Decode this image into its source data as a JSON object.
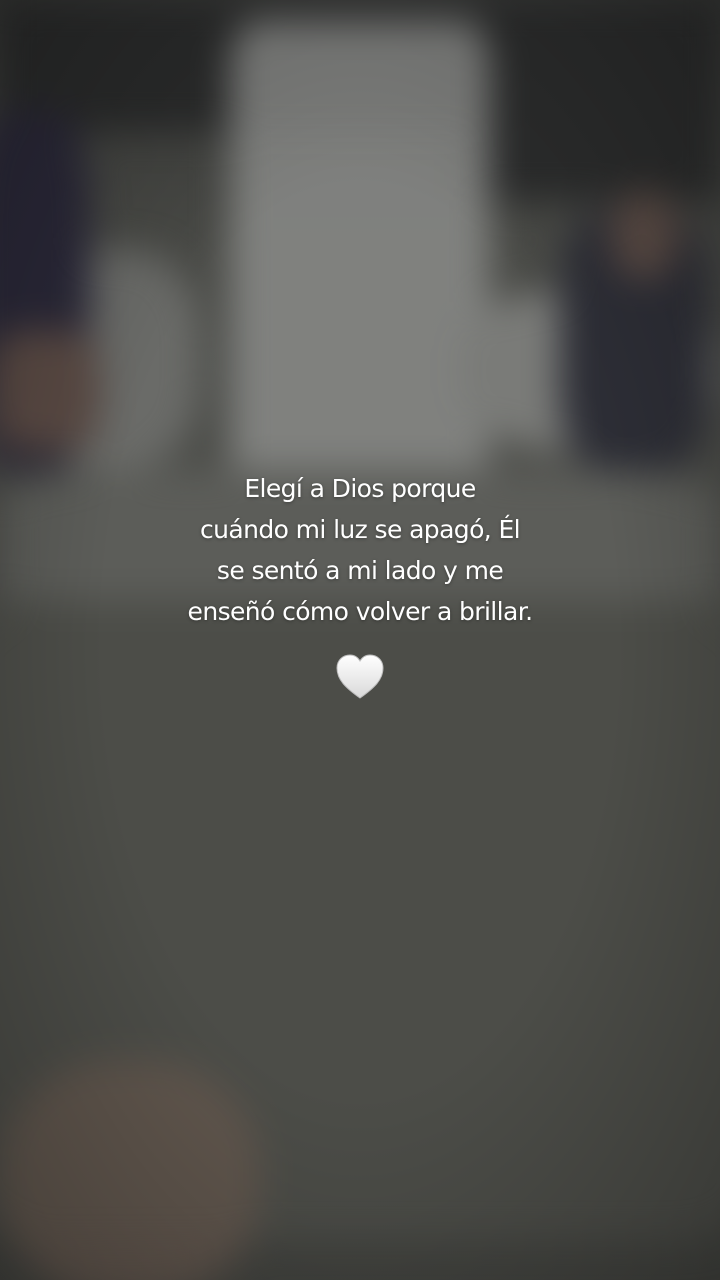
{
  "caption": {
    "lines": [
      "Elegí a Dios porque",
      "cuándo mi luz se apagó, Él",
      "se sentó a mi lado y me",
      "enseñó cómo volver a brillar."
    ]
  },
  "icons": {
    "heart": "white-heart-icon"
  },
  "colors": {
    "text": "#ffffff",
    "background": "#4a4b47"
  }
}
